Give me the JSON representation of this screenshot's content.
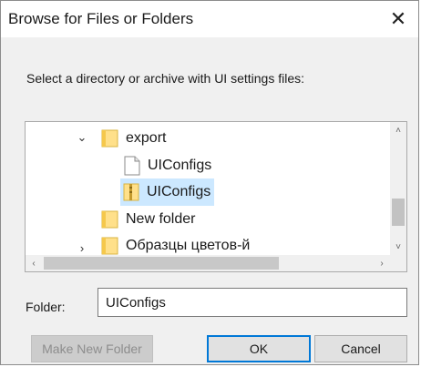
{
  "window": {
    "title": "Browse for Files or Folders",
    "close_glyph": "✕"
  },
  "instruction": "Select a directory or archive with UI settings files:",
  "tree": {
    "items": [
      {
        "label": "export",
        "type": "folder",
        "expanded": true,
        "icon": "folder-icon"
      },
      {
        "label": "UIConfigs",
        "type": "file",
        "icon": "file-icon"
      },
      {
        "label": "UIConfigs",
        "type": "folder",
        "selected": true,
        "icon": "folder-zip-icon"
      },
      {
        "label": "New folder",
        "type": "folder",
        "icon": "folder-icon"
      },
      {
        "label": "Образцы цветов-й",
        "type": "folder",
        "collapsed": true,
        "icon": "folder-icon"
      }
    ],
    "expanded_glyph": "⌄",
    "collapsed_glyph": "›",
    "scroll_up_glyph": "˄",
    "scroll_down_glyph": "˅",
    "scroll_left_glyph": "‹",
    "scroll_right_glyph": "›"
  },
  "folder_field": {
    "label": "Folder:",
    "value": "UIConfigs"
  },
  "buttons": {
    "make_new_folder": "Make New Folder",
    "ok": "OK",
    "cancel": "Cancel"
  },
  "colors": {
    "accent": "#0078d7",
    "selection": "#cce8ff",
    "folder": "#ffd966"
  }
}
